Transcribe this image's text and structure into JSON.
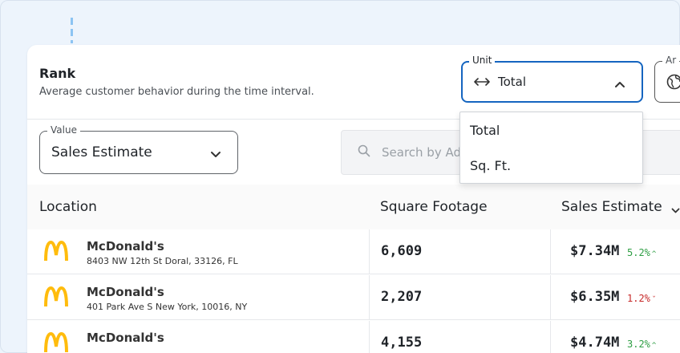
{
  "header": {
    "title": "Rank",
    "subtitle": "Average customer behavior during the time interval."
  },
  "unit_select": {
    "legend": "Unit",
    "value": "Total",
    "icon": "horizontal-arrows-icon",
    "options": [
      "Total",
      "Sq. Ft."
    ]
  },
  "area_select": {
    "legend": "Ar",
    "icon": "globe-icon"
  },
  "value_select": {
    "legend": "Value",
    "value": "Sales Estimate"
  },
  "search": {
    "placeholder": "Search by Ad"
  },
  "table": {
    "columns": [
      "Location",
      "Square Footage",
      "Sales Estimate"
    ],
    "sort_indicator": "chevron-down-icon",
    "rows": [
      {
        "name": "McDonald's",
        "address": "8403 NW 12th St Doral, 33126, FL",
        "sqft": "6,609",
        "sales": "$7.34M",
        "change": "5.2%",
        "trend": "up"
      },
      {
        "name": "McDonald's",
        "address": "401 Park Ave S New York, 10016, NY",
        "sqft": "2,207",
        "sales": "$6.35M",
        "change": "1.2%",
        "trend": "down"
      },
      {
        "name": "McDonald's",
        "address": "",
        "sqft": "4,155",
        "sales": "$4.74M",
        "change": "3.2%",
        "trend": "up"
      }
    ]
  },
  "colors": {
    "accent": "#1565c0",
    "positive": "#2e9e44",
    "negative": "#c62828",
    "logo": "#ffbc0d"
  }
}
